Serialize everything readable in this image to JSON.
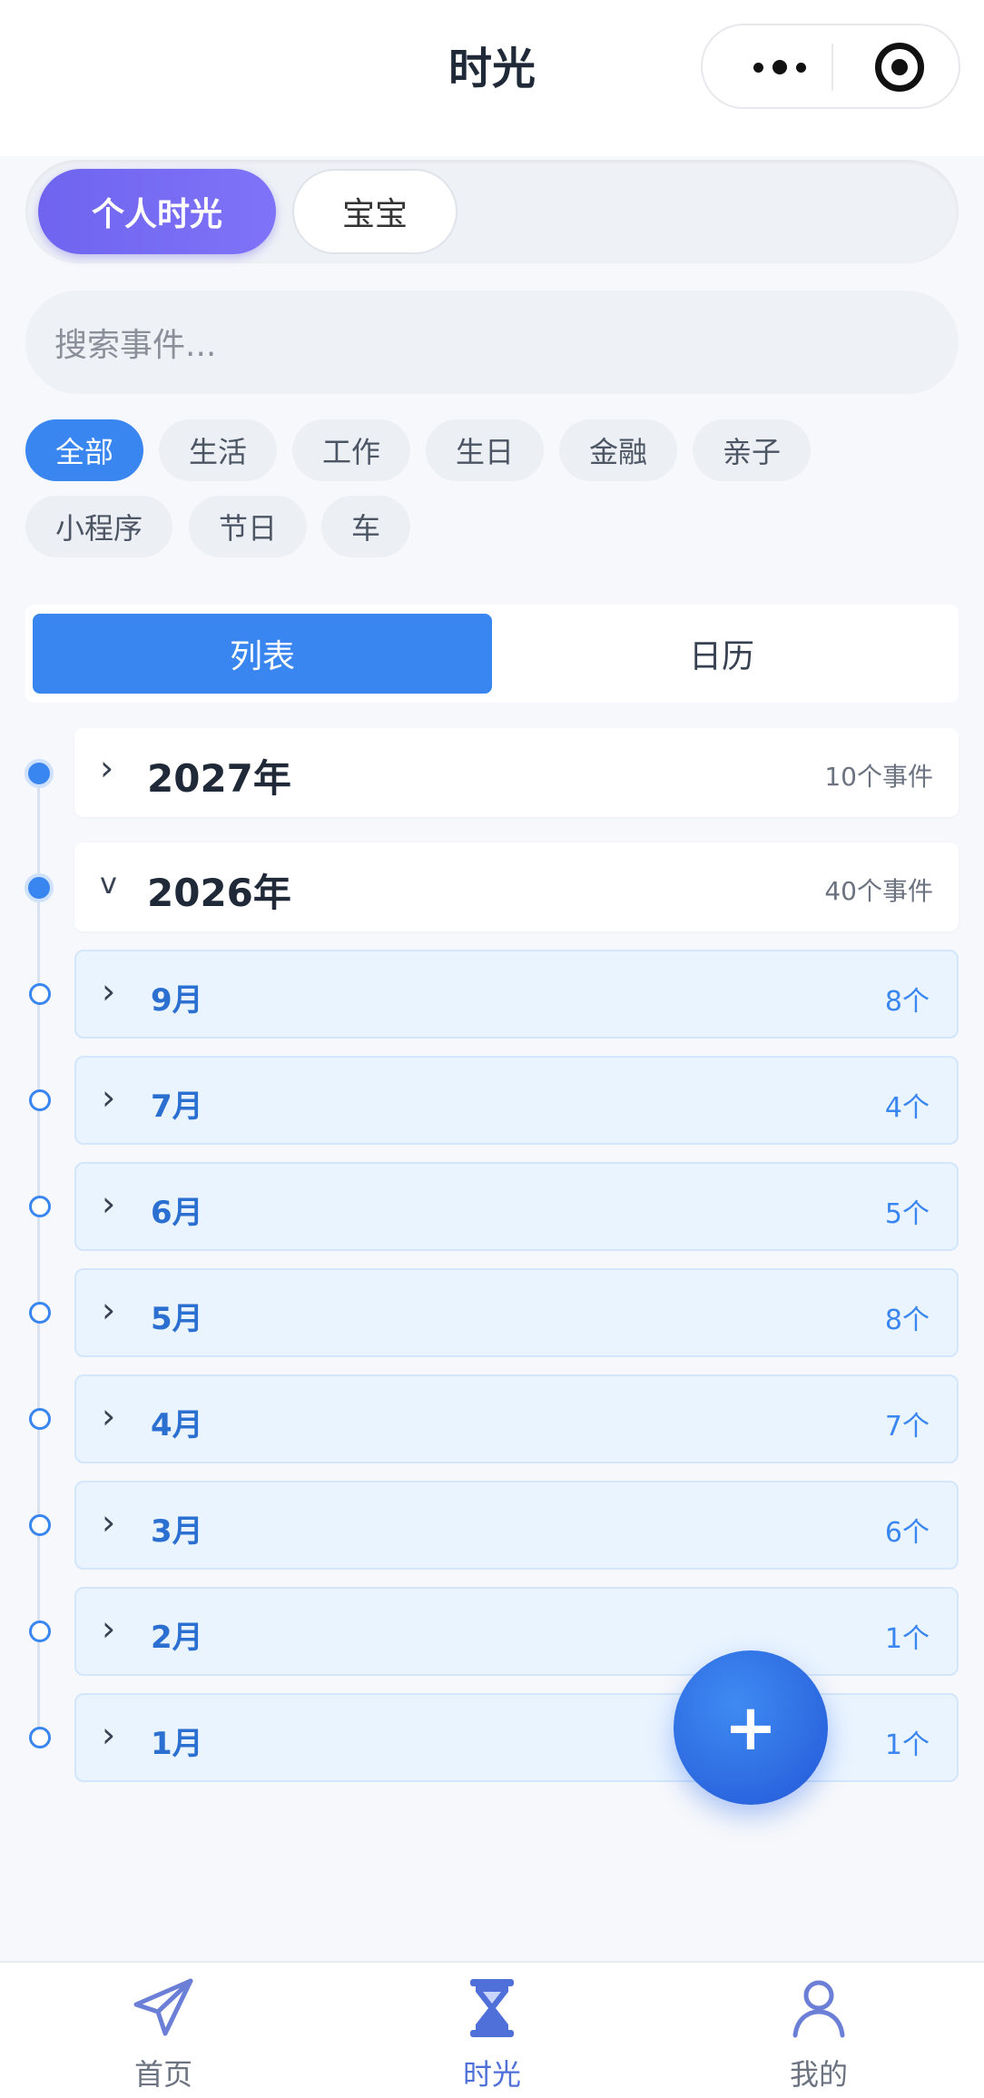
{
  "header": {
    "title": "时光"
  },
  "scope_tabs": [
    {
      "label": "个人时光",
      "active": true
    },
    {
      "label": "宝宝",
      "active": false
    }
  ],
  "search": {
    "placeholder": "搜索事件..."
  },
  "categories": [
    {
      "label": "全部",
      "active": true
    },
    {
      "label": "生活"
    },
    {
      "label": "工作"
    },
    {
      "label": "生日"
    },
    {
      "label": "金融"
    },
    {
      "label": "亲子"
    },
    {
      "label": "小程序"
    },
    {
      "label": "节日"
    },
    {
      "label": "车"
    }
  ],
  "view_toggle": {
    "list": "列表",
    "calendar": "日历",
    "active": "列表"
  },
  "timeline": {
    "years": [
      {
        "year": "2027年",
        "count": "10个事件",
        "expanded": false
      },
      {
        "year": "2026年",
        "count": "40个事件",
        "expanded": true
      }
    ],
    "months": [
      {
        "month": "9月",
        "count": "8个"
      },
      {
        "month": "7月",
        "count": "4个"
      },
      {
        "month": "6月",
        "count": "5个"
      },
      {
        "month": "5月",
        "count": "8个"
      },
      {
        "month": "4月",
        "count": "7个"
      },
      {
        "month": "3月",
        "count": "6个"
      },
      {
        "month": "2月",
        "count": "1个"
      },
      {
        "month": "1月",
        "count": "1个"
      }
    ]
  },
  "fab": {
    "label": "+"
  },
  "tabbar": [
    {
      "label": "首页",
      "icon": "send-icon",
      "active": false
    },
    {
      "label": "时光",
      "icon": "hourglass-icon",
      "active": true
    },
    {
      "label": "我的",
      "icon": "user-icon",
      "active": false
    }
  ],
  "colors": {
    "accent": "#3a86f0",
    "scope_active": "#6f64ef",
    "month_bg": "#eaf4ff"
  }
}
